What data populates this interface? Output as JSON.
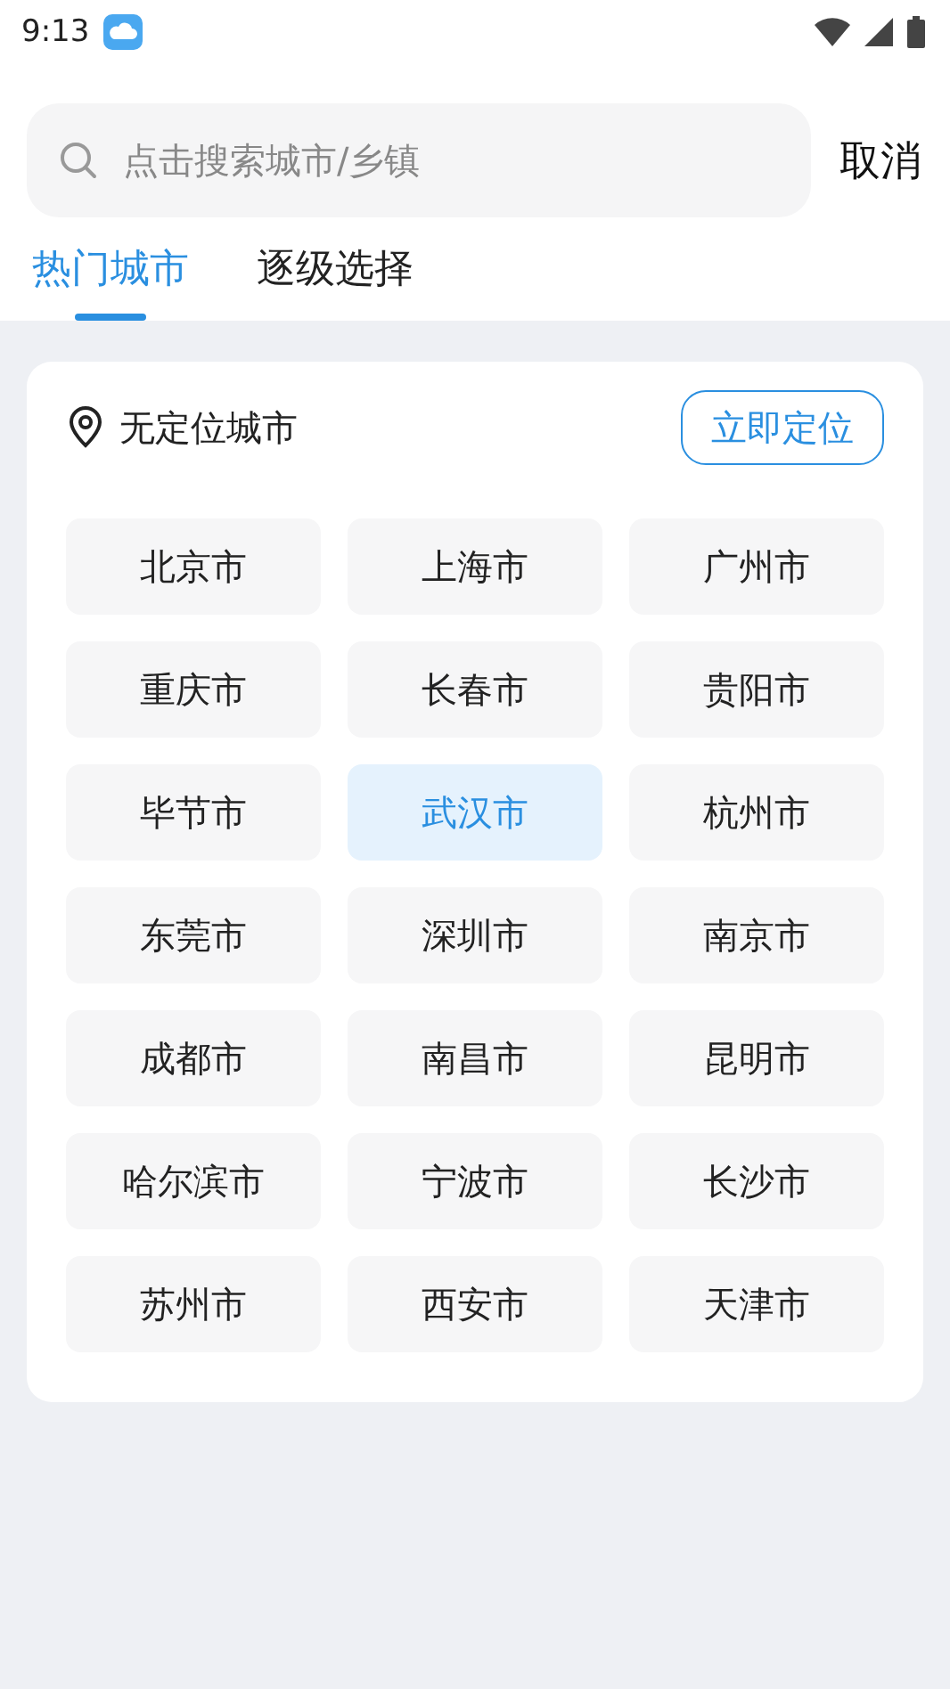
{
  "status_bar": {
    "time": "9:13"
  },
  "search": {
    "placeholder": "点击搜索城市/乡镇"
  },
  "cancel": "取消",
  "tabs": [
    {
      "label": "热门城市",
      "selected": true
    },
    {
      "label": "逐级选择",
      "selected": false
    }
  ],
  "location": {
    "label": "无定位城市",
    "button": "立即定位"
  },
  "cities": [
    {
      "name": "北京市",
      "selected": false
    },
    {
      "name": "上海市",
      "selected": false
    },
    {
      "name": "广州市",
      "selected": false
    },
    {
      "name": "重庆市",
      "selected": false
    },
    {
      "name": "长春市",
      "selected": false
    },
    {
      "name": "贵阳市",
      "selected": false
    },
    {
      "name": "毕节市",
      "selected": false
    },
    {
      "name": "武汉市",
      "selected": true
    },
    {
      "name": "杭州市",
      "selected": false
    },
    {
      "name": "东莞市",
      "selected": false
    },
    {
      "name": "深圳市",
      "selected": false
    },
    {
      "name": "南京市",
      "selected": false
    },
    {
      "name": "成都市",
      "selected": false
    },
    {
      "name": "南昌市",
      "selected": false
    },
    {
      "name": "昆明市",
      "selected": false
    },
    {
      "name": "哈尔滨市",
      "selected": false
    },
    {
      "name": "宁波市",
      "selected": false
    },
    {
      "name": "长沙市",
      "selected": false
    },
    {
      "name": "苏州市",
      "selected": false
    },
    {
      "name": "西安市",
      "selected": false
    },
    {
      "name": "天津市",
      "selected": false
    }
  ]
}
